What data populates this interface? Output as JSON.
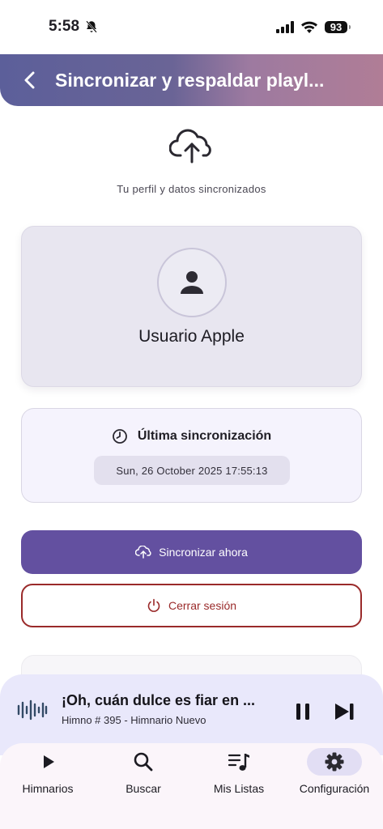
{
  "status_bar": {
    "time": "5:58",
    "battery": "93"
  },
  "header": {
    "title": "Sincronizar y respaldar playl..."
  },
  "profile": {
    "subtitle": "Tu perfil y datos sincronizados",
    "user_name": "Usuario Apple"
  },
  "sync": {
    "title": "Última sincronización",
    "last_date": "Sun, 26 October 2025 17:55:13"
  },
  "actions": {
    "sync_now": "Sincronizar ahora",
    "logout": "Cerrar sesión"
  },
  "player": {
    "title": "¡Oh, cuán dulce es fiar en ...",
    "subtitle": "Himno # 395 - Himnario Nuevo"
  },
  "nav": {
    "items": [
      {
        "label": "Himnarios",
        "icon": "play-icon",
        "active": false
      },
      {
        "label": "Buscar",
        "icon": "search-icon",
        "active": false
      },
      {
        "label": "Mis Listas",
        "icon": "playlist-icon",
        "active": false
      },
      {
        "label": "Configuración",
        "icon": "gear-icon",
        "active": true
      }
    ]
  },
  "colors": {
    "primary": "#6350a0",
    "danger": "#9a2a2a",
    "player_bg": "#e9e8fb"
  }
}
